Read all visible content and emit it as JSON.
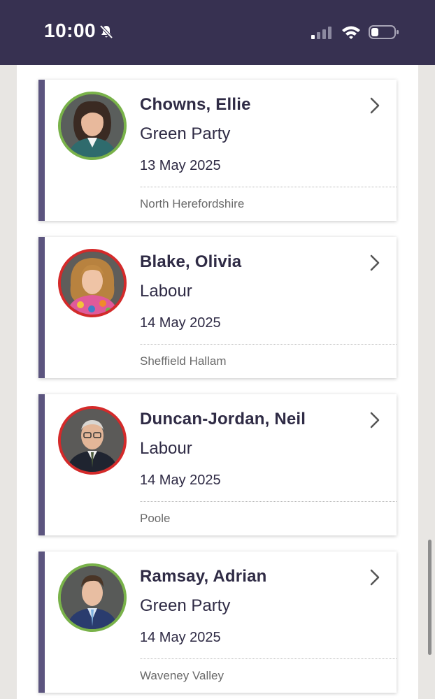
{
  "status_bar": {
    "time": "10:00",
    "icons": [
      "bell-slash-icon",
      "cellular-signal-icon",
      "wifi-icon",
      "battery-icon"
    ]
  },
  "colors": {
    "header_bg": "#373151",
    "card_accent": "#5c557f",
    "green_party": "#79b24a",
    "labour": "#d42a2a",
    "text_primary": "#2f2b45",
    "text_secondary": "#6a6a6a"
  },
  "members": [
    {
      "name": "Chowns, Ellie",
      "party": "Green Party",
      "date": "13 May 2025",
      "constituency": "North Herefordshire",
      "party_color": "#79b24a"
    },
    {
      "name": "Blake, Olivia",
      "party": "Labour",
      "date": "14 May 2025",
      "constituency": "Sheffield Hallam",
      "party_color": "#d42a2a"
    },
    {
      "name": "Duncan-Jordan, Neil",
      "party": "Labour",
      "date": "14 May 2025",
      "constituency": "Poole",
      "party_color": "#d42a2a"
    },
    {
      "name": "Ramsay, Adrian",
      "party": "Green Party",
      "date": "14 May 2025",
      "constituency": "Waveney Valley",
      "party_color": "#79b24a"
    }
  ]
}
